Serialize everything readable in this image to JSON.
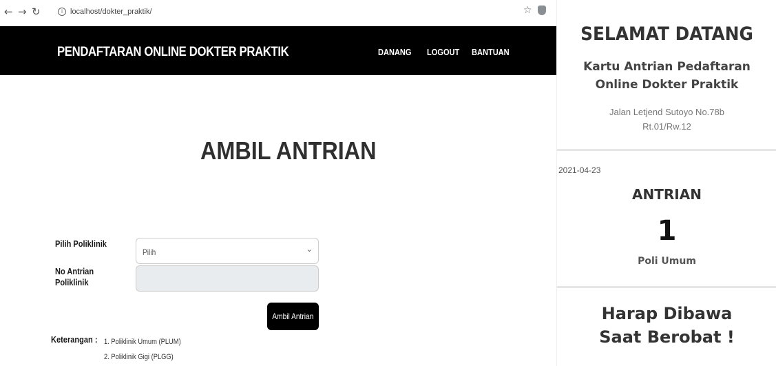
{
  "browser": {
    "back_icon": "back-arrow-icon",
    "forward_icon": "forward-arrow-icon",
    "reload_icon": "reload-icon",
    "url": "localhost/dokter_praktik/",
    "bookmark_icon": "star-icon",
    "extension_icon": "extension-icon"
  },
  "navbar": {
    "brand": "PENDAFTARAN ONLINE DOKTER PRAKTIK",
    "links": [
      "DANANG",
      "LOGOUT",
      "BANTUAN"
    ]
  },
  "main": {
    "heading": "AMBIL ANTRIAN",
    "form": {
      "poliklinik_label": "Pilih Poliklinik",
      "poliklinik_value": "Pilih",
      "no_antrian_label_line1": "No Antrian",
      "no_antrian_label_line2": "Poliklinik",
      "no_antrian_value": ""
    },
    "submit_label": "Ambil Antrian",
    "keterangan": {
      "label": "Keterangan :",
      "items": [
        "1. Poliklinik Umum (PLUM)",
        "2. Poliklinik Gigi (PLGG)"
      ]
    }
  },
  "ticket": {
    "welcome": "SELAMAT DATANG",
    "title_line1": "Kartu Antrian Pedaftaran",
    "title_line2": "Online Dokter Praktik",
    "address_line1": "Jalan Letjend Sutoyo No.78b",
    "address_line2": "Rt.01/Rw.12",
    "date": "2021-04-23",
    "antrian_label": "ANTRIAN",
    "number": "1",
    "poli": "Poli Umum",
    "note_line1": "Harap Dibawa",
    "note_line2": "Saat Berobat !"
  },
  "colors": {
    "navbar_bg": "#000000",
    "button_bg": "#000000",
    "readonly_bg": "#e9ecef"
  }
}
